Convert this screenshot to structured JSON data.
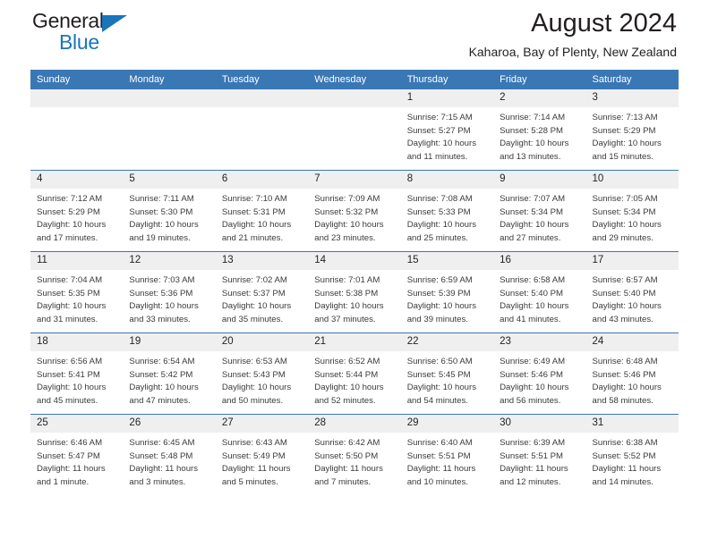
{
  "brand": {
    "name_part1": "General",
    "name_part2": "Blue",
    "accent_color": "#1a75bb"
  },
  "header": {
    "title": "August 2024",
    "subtitle": "Kaharoa, Bay of Plenty, New Zealand",
    "header_bg_color": "#3a77b5",
    "daynum_bg_color": "#efefef"
  },
  "weekdays": [
    "Sunday",
    "Monday",
    "Tuesday",
    "Wednesday",
    "Thursday",
    "Friday",
    "Saturday"
  ],
  "weeks": [
    [
      {
        "day": "",
        "sunrise": "",
        "sunset": "",
        "daylight_line1": "",
        "daylight_line2": ""
      },
      {
        "day": "",
        "sunrise": "",
        "sunset": "",
        "daylight_line1": "",
        "daylight_line2": ""
      },
      {
        "day": "",
        "sunrise": "",
        "sunset": "",
        "daylight_line1": "",
        "daylight_line2": ""
      },
      {
        "day": "",
        "sunrise": "",
        "sunset": "",
        "daylight_line1": "",
        "daylight_line2": ""
      },
      {
        "day": "1",
        "sunrise": "Sunrise: 7:15 AM",
        "sunset": "Sunset: 5:27 PM",
        "daylight_line1": "Daylight: 10 hours",
        "daylight_line2": "and 11 minutes."
      },
      {
        "day": "2",
        "sunrise": "Sunrise: 7:14 AM",
        "sunset": "Sunset: 5:28 PM",
        "daylight_line1": "Daylight: 10 hours",
        "daylight_line2": "and 13 minutes."
      },
      {
        "day": "3",
        "sunrise": "Sunrise: 7:13 AM",
        "sunset": "Sunset: 5:29 PM",
        "daylight_line1": "Daylight: 10 hours",
        "daylight_line2": "and 15 minutes."
      }
    ],
    [
      {
        "day": "4",
        "sunrise": "Sunrise: 7:12 AM",
        "sunset": "Sunset: 5:29 PM",
        "daylight_line1": "Daylight: 10 hours",
        "daylight_line2": "and 17 minutes."
      },
      {
        "day": "5",
        "sunrise": "Sunrise: 7:11 AM",
        "sunset": "Sunset: 5:30 PM",
        "daylight_line1": "Daylight: 10 hours",
        "daylight_line2": "and 19 minutes."
      },
      {
        "day": "6",
        "sunrise": "Sunrise: 7:10 AM",
        "sunset": "Sunset: 5:31 PM",
        "daylight_line1": "Daylight: 10 hours",
        "daylight_line2": "and 21 minutes."
      },
      {
        "day": "7",
        "sunrise": "Sunrise: 7:09 AM",
        "sunset": "Sunset: 5:32 PM",
        "daylight_line1": "Daylight: 10 hours",
        "daylight_line2": "and 23 minutes."
      },
      {
        "day": "8",
        "sunrise": "Sunrise: 7:08 AM",
        "sunset": "Sunset: 5:33 PM",
        "daylight_line1": "Daylight: 10 hours",
        "daylight_line2": "and 25 minutes."
      },
      {
        "day": "9",
        "sunrise": "Sunrise: 7:07 AM",
        "sunset": "Sunset: 5:34 PM",
        "daylight_line1": "Daylight: 10 hours",
        "daylight_line2": "and 27 minutes."
      },
      {
        "day": "10",
        "sunrise": "Sunrise: 7:05 AM",
        "sunset": "Sunset: 5:34 PM",
        "daylight_line1": "Daylight: 10 hours",
        "daylight_line2": "and 29 minutes."
      }
    ],
    [
      {
        "day": "11",
        "sunrise": "Sunrise: 7:04 AM",
        "sunset": "Sunset: 5:35 PM",
        "daylight_line1": "Daylight: 10 hours",
        "daylight_line2": "and 31 minutes."
      },
      {
        "day": "12",
        "sunrise": "Sunrise: 7:03 AM",
        "sunset": "Sunset: 5:36 PM",
        "daylight_line1": "Daylight: 10 hours",
        "daylight_line2": "and 33 minutes."
      },
      {
        "day": "13",
        "sunrise": "Sunrise: 7:02 AM",
        "sunset": "Sunset: 5:37 PM",
        "daylight_line1": "Daylight: 10 hours",
        "daylight_line2": "and 35 minutes."
      },
      {
        "day": "14",
        "sunrise": "Sunrise: 7:01 AM",
        "sunset": "Sunset: 5:38 PM",
        "daylight_line1": "Daylight: 10 hours",
        "daylight_line2": "and 37 minutes."
      },
      {
        "day": "15",
        "sunrise": "Sunrise: 6:59 AM",
        "sunset": "Sunset: 5:39 PM",
        "daylight_line1": "Daylight: 10 hours",
        "daylight_line2": "and 39 minutes."
      },
      {
        "day": "16",
        "sunrise": "Sunrise: 6:58 AM",
        "sunset": "Sunset: 5:40 PM",
        "daylight_line1": "Daylight: 10 hours",
        "daylight_line2": "and 41 minutes."
      },
      {
        "day": "17",
        "sunrise": "Sunrise: 6:57 AM",
        "sunset": "Sunset: 5:40 PM",
        "daylight_line1": "Daylight: 10 hours",
        "daylight_line2": "and 43 minutes."
      }
    ],
    [
      {
        "day": "18",
        "sunrise": "Sunrise: 6:56 AM",
        "sunset": "Sunset: 5:41 PM",
        "daylight_line1": "Daylight: 10 hours",
        "daylight_line2": "and 45 minutes."
      },
      {
        "day": "19",
        "sunrise": "Sunrise: 6:54 AM",
        "sunset": "Sunset: 5:42 PM",
        "daylight_line1": "Daylight: 10 hours",
        "daylight_line2": "and 47 minutes."
      },
      {
        "day": "20",
        "sunrise": "Sunrise: 6:53 AM",
        "sunset": "Sunset: 5:43 PM",
        "daylight_line1": "Daylight: 10 hours",
        "daylight_line2": "and 50 minutes."
      },
      {
        "day": "21",
        "sunrise": "Sunrise: 6:52 AM",
        "sunset": "Sunset: 5:44 PM",
        "daylight_line1": "Daylight: 10 hours",
        "daylight_line2": "and 52 minutes."
      },
      {
        "day": "22",
        "sunrise": "Sunrise: 6:50 AM",
        "sunset": "Sunset: 5:45 PM",
        "daylight_line1": "Daylight: 10 hours",
        "daylight_line2": "and 54 minutes."
      },
      {
        "day": "23",
        "sunrise": "Sunrise: 6:49 AM",
        "sunset": "Sunset: 5:46 PM",
        "daylight_line1": "Daylight: 10 hours",
        "daylight_line2": "and 56 minutes."
      },
      {
        "day": "24",
        "sunrise": "Sunrise: 6:48 AM",
        "sunset": "Sunset: 5:46 PM",
        "daylight_line1": "Daylight: 10 hours",
        "daylight_line2": "and 58 minutes."
      }
    ],
    [
      {
        "day": "25",
        "sunrise": "Sunrise: 6:46 AM",
        "sunset": "Sunset: 5:47 PM",
        "daylight_line1": "Daylight: 11 hours",
        "daylight_line2": "and 1 minute."
      },
      {
        "day": "26",
        "sunrise": "Sunrise: 6:45 AM",
        "sunset": "Sunset: 5:48 PM",
        "daylight_line1": "Daylight: 11 hours",
        "daylight_line2": "and 3 minutes."
      },
      {
        "day": "27",
        "sunrise": "Sunrise: 6:43 AM",
        "sunset": "Sunset: 5:49 PM",
        "daylight_line1": "Daylight: 11 hours",
        "daylight_line2": "and 5 minutes."
      },
      {
        "day": "28",
        "sunrise": "Sunrise: 6:42 AM",
        "sunset": "Sunset: 5:50 PM",
        "daylight_line1": "Daylight: 11 hours",
        "daylight_line2": "and 7 minutes."
      },
      {
        "day": "29",
        "sunrise": "Sunrise: 6:40 AM",
        "sunset": "Sunset: 5:51 PM",
        "daylight_line1": "Daylight: 11 hours",
        "daylight_line2": "and 10 minutes."
      },
      {
        "day": "30",
        "sunrise": "Sunrise: 6:39 AM",
        "sunset": "Sunset: 5:51 PM",
        "daylight_line1": "Daylight: 11 hours",
        "daylight_line2": "and 12 minutes."
      },
      {
        "day": "31",
        "sunrise": "Sunrise: 6:38 AM",
        "sunset": "Sunset: 5:52 PM",
        "daylight_line1": "Daylight: 11 hours",
        "daylight_line2": "and 14 minutes."
      }
    ]
  ]
}
